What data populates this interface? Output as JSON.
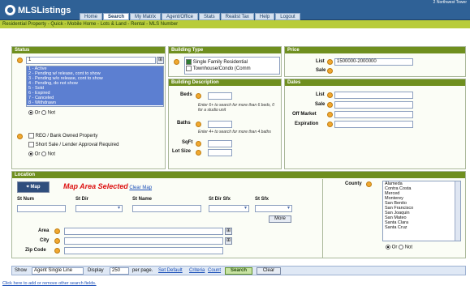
{
  "header": {
    "logo": "MLSListings",
    "ticker": "2 Northwest Tower",
    "tabs": [
      "Home",
      "Search",
      "My Matrix",
      "Agent/Office",
      "Stats",
      "Realist Tax",
      "Help",
      "Logout"
    ]
  },
  "subnav": "Residential Property - Quick - Mobile Home - Lots & Land - Rental - MLS Number",
  "status": {
    "title": "Status",
    "value": "1",
    "options": [
      "1 - Active",
      "2 - Pending w/ release, cont to show",
      "3 - Pending w/o release, cont to show",
      "4 - Pending, do not show",
      "5 - Sold",
      "6 - Expired",
      "7 - Canceled",
      "8 - Withdrawn"
    ],
    "or_label": "Or",
    "not_label": "Not",
    "reo": "REO / Bank Owned Property",
    "short_sale": "Short Sale / Lender Approval Required"
  },
  "building_type": {
    "title": "Building Type",
    "options": [
      "Single Family Residential",
      "Townhouse/Condo (Comm"
    ]
  },
  "building_desc": {
    "title": "Building Description",
    "beds": "Beds",
    "beds_hint": "Enter 6+ to search for more than 6 beds, 0 for a studio unit",
    "baths": "Baths",
    "baths_hint": "Enter 4+ to search for more than 4 baths",
    "sqft": "SqFt",
    "lot_size": "Lot Size"
  },
  "price": {
    "title": "Price",
    "list": "List",
    "list_value": "1500000-2000000",
    "sale": "Sale"
  },
  "dates": {
    "title": "Dates",
    "list": "List",
    "sale": "Sale",
    "off_market": "Off Market",
    "expiration": "Expiration"
  },
  "location": {
    "title": "Location",
    "map_button": "Map Search",
    "map_area": "Map Area Selected",
    "clear_map": "Clear Map",
    "cols": [
      "St Num",
      "St Dir",
      "St Name",
      "St Dir Sfx",
      "St Sfx"
    ],
    "more": "More",
    "area": "Area",
    "city": "City",
    "zip": "Zip Code",
    "county": "County",
    "counties": [
      "Alameda",
      "Contra Costa",
      "Merced",
      "Monterey",
      "San Benito",
      "San Francisco",
      "San Joaquin",
      "San Mateo",
      "Santa Clara",
      "Santa Cruz"
    ],
    "or_label": "Or",
    "not_label": "Not"
  },
  "footer": {
    "show": "Show",
    "show_value": "Agent Single Line",
    "display": "Display",
    "display_value": "250",
    "per_page": "per page.",
    "set_default": "Set Default",
    "criteria": "Criteria",
    "count": "Count",
    "search": "Search",
    "clear": "Clear",
    "bottom_link": "Click here to add or remove other search fields."
  },
  "colors": {
    "topbar": "#2f6196",
    "subbar": "#b8cc3a",
    "panel_header": "#6f8f1f",
    "selected": "#5c7fd1",
    "map_area_text": "#dd1111"
  }
}
